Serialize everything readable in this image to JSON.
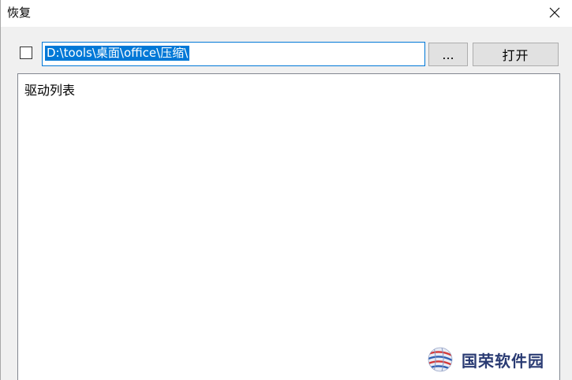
{
  "window": {
    "title": "恢复",
    "close_glyph": "✕"
  },
  "toolbar": {
    "path_value": "D:\\tools\\桌面\\office\\压缩\\",
    "browse_label": "...",
    "open_label": "打开",
    "accent_color": "#0078d7"
  },
  "list": {
    "label": "驱动列表"
  },
  "watermark": {
    "text": "国荣软件园",
    "icon": "globe-logo-icon"
  }
}
